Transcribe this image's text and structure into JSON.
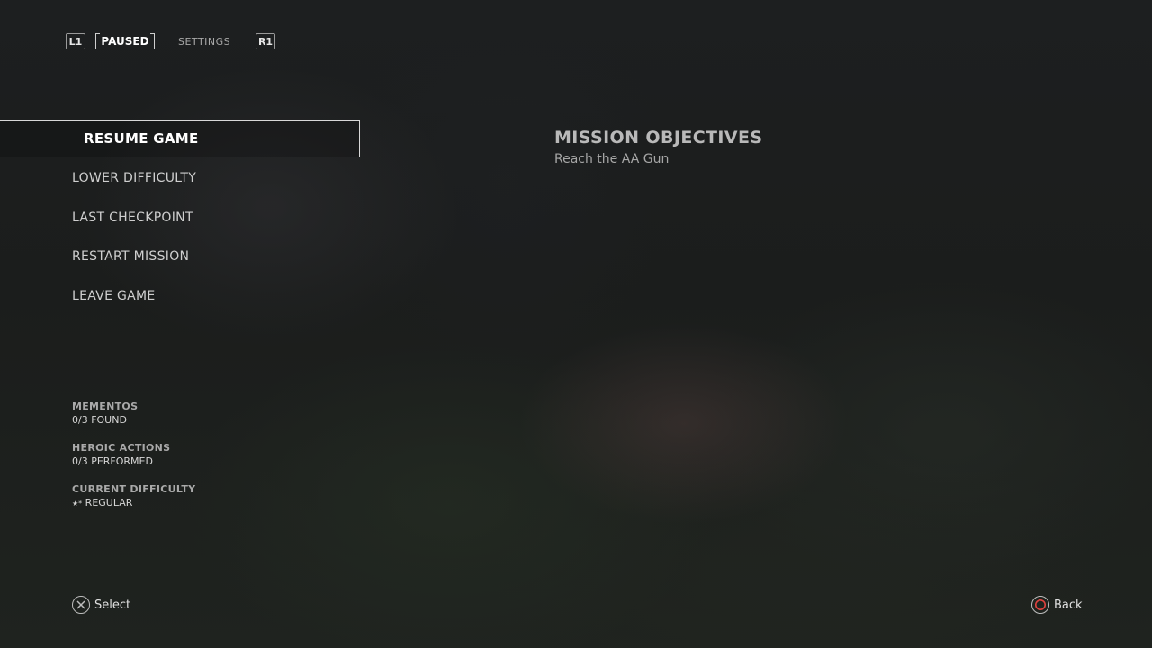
{
  "top_nav": {
    "left_key": "L1",
    "active_tab": "PAUSED",
    "inactive_tab": "SETTINGS",
    "right_key": "R1"
  },
  "menu": {
    "items": [
      {
        "label": "RESUME GAME",
        "selected": true
      },
      {
        "label": "LOWER DIFFICULTY",
        "selected": false
      },
      {
        "label": "LAST CHECKPOINT",
        "selected": false
      },
      {
        "label": "RESTART MISSION",
        "selected": false
      },
      {
        "label": "LEAVE GAME",
        "selected": false
      }
    ]
  },
  "objectives": {
    "title": "MISSION OBJECTIVES",
    "text": "Reach the AA Gun"
  },
  "stats": {
    "mementos": {
      "label": "MEMENTOS",
      "value": "0/3 FOUND"
    },
    "heroic": {
      "label": "HEROIC ACTIONS",
      "value": "0/3 PERFORMED"
    },
    "difficulty": {
      "label": "CURRENT DIFFICULTY",
      "value": "REGULAR",
      "icon": "star-icon"
    }
  },
  "prompts": {
    "select": {
      "label": "Select",
      "icon": "cross-button-icon",
      "color": "#bdbdbd"
    },
    "back": {
      "label": "Back",
      "icon": "circle-button-icon",
      "color": "#e0433f"
    }
  }
}
